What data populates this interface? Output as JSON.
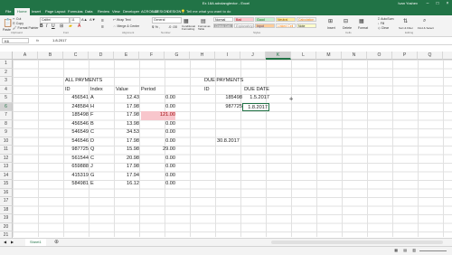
{
  "app": {
    "title": "Ex 18A advdanglevtor - Excel",
    "user": "Ivan Yoshev"
  },
  "tabs": [
    "File",
    "Home",
    "Insert",
    "Page Layout",
    "Formulas",
    "Data",
    "Review",
    "View",
    "Developer",
    "ACROBAT",
    "DESIGN",
    "DESIGN"
  ],
  "tell_me": "Tell me what you want to do",
  "ribbon": {
    "paste": "Paste",
    "cut": "Cut",
    "copy": "Copy",
    "format_painter": "Format Painter",
    "font": "Calibri",
    "font_size": "11",
    "wrap_text": "Wrap Text",
    "merge_center": "Merge & Center",
    "number_format": "General",
    "conditional_formatting": "Conditional Formatting",
    "format_as_table": "Format as Table",
    "styles": [
      "Normal",
      "Bad",
      "Good",
      "Neutral",
      "Calculation",
      "Check Cell",
      "Explanatory...",
      "Input",
      "Linked Cell",
      "Note"
    ],
    "insert": "Insert",
    "delete": "Delete",
    "format": "Format",
    "autosum": "AutoSum",
    "fill": "Fill",
    "clear": "Clear",
    "sort_filter": "Sort & Filter",
    "find_select": "Find & Select",
    "groups": [
      "Clipboard",
      "Font",
      "Alignment",
      "Number",
      "Styles",
      "Cells",
      "Editing"
    ]
  },
  "formula_bar": {
    "name_box": "K6",
    "fx": "fx",
    "value": "1.8.2017"
  },
  "columns": [
    "A",
    "B",
    "C",
    "D",
    "E",
    "F",
    "G",
    "H",
    "I",
    "J",
    "K",
    "L",
    "M",
    "N",
    "O",
    "P",
    "Q",
    "R"
  ],
  "rows": [
    "1",
    "2",
    "3",
    "4",
    "5",
    "6",
    "7",
    "8",
    "9",
    "10",
    "11",
    "12",
    "13",
    "14",
    "15",
    "16",
    "17",
    "18",
    "19",
    "20",
    "21"
  ],
  "cells": {
    "all_payments": "ALL PAYMENTS",
    "due_payments": "DUE PAYMENTS",
    "h_id": "ID",
    "h_index": "Index",
    "h_value": "Value",
    "h_period": "Period",
    "h_id2": "ID",
    "h_due_date": "DUE DATE",
    "payments": [
      {
        "id": "456541",
        "index": "A",
        "value": "12.43",
        "period": "0.00"
      },
      {
        "id": "248584",
        "index": "H",
        "value": "17.98",
        "period": "0.00"
      },
      {
        "id": "185498",
        "index": "F",
        "value": "17.98",
        "period": "121.00"
      },
      {
        "id": "456546",
        "index": "B",
        "value": "13.98",
        "period": "0.00"
      },
      {
        "id": "546549",
        "index": "C",
        "value": "34.53",
        "period": "0.00"
      },
      {
        "id": "546546",
        "index": "D",
        "value": "17.98",
        "period": "0.00"
      },
      {
        "id": "987725",
        "index": "Q",
        "value": "15.98",
        "period": "29.00"
      },
      {
        "id": "561544",
        "index": "C",
        "value": "20.98",
        "period": "0.00"
      },
      {
        "id": "659888",
        "index": "J",
        "value": "17.98",
        "period": "0.00"
      },
      {
        "id": "415319",
        "index": "G",
        "value": "17.94",
        "period": "0.00"
      },
      {
        "id": "584981",
        "index": "E",
        "value": "16.12",
        "period": "0.00"
      }
    ],
    "due": [
      {
        "id": "185498",
        "date": "1.5.2017"
      },
      {
        "id": "987725",
        "date": "1.8.2017"
      }
    ],
    "j10": "30.8.2017"
  },
  "sheet_tab": "Sheet1",
  "accent": "#217346",
  "highlight_fill": "#f8c6cc",
  "highlight_text": "#9c0006"
}
